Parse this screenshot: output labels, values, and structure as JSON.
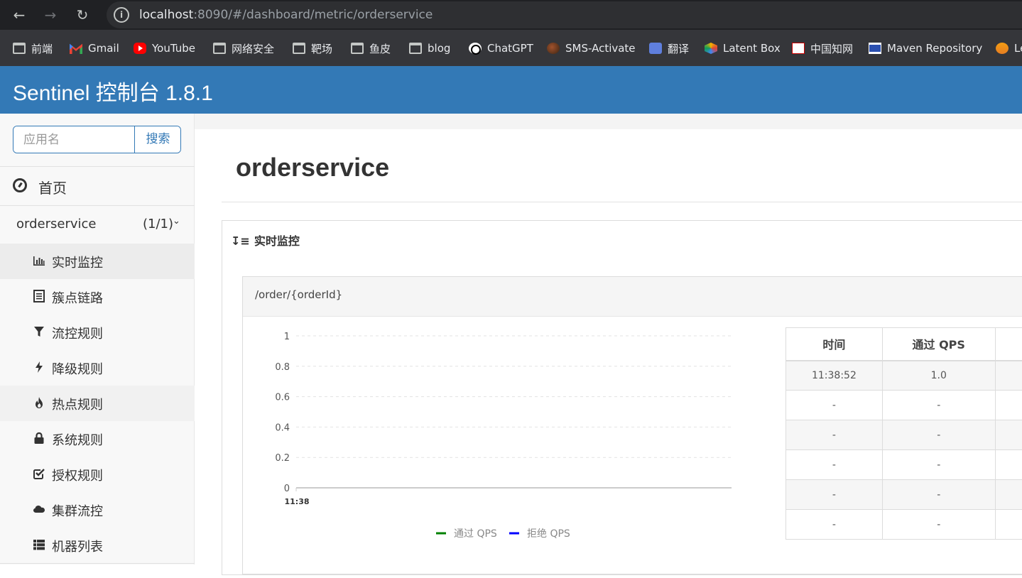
{
  "browser": {
    "url_host": "localhost",
    "url_rest": ":8090/#/dashboard/metric/orderservice",
    "bookmarks": [
      "前端",
      "Gmail",
      "YouTube",
      "网络安全",
      "靶场",
      "鱼皮",
      "blog",
      "ChatGPT",
      "SMS-Activate",
      "翻译",
      "Latent Box",
      "中国知网",
      "Maven Repository",
      "Le"
    ]
  },
  "header": {
    "title": "Sentinel 控制台 1.8.1"
  },
  "sidebar": {
    "search_placeholder": "应用名",
    "search_button": "搜索",
    "home_label": "首页",
    "app": {
      "name": "orderservice",
      "count": "(1/1)"
    },
    "menu": [
      {
        "label": "实时监控",
        "icon": "bar-chart-icon"
      },
      {
        "label": "簇点链路",
        "icon": "list-icon"
      },
      {
        "label": "流控规则",
        "icon": "filter-icon"
      },
      {
        "label": "降级规则",
        "icon": "flash-icon"
      },
      {
        "label": "热点规则",
        "icon": "fire-icon"
      },
      {
        "label": "系统规则",
        "icon": "lock-icon"
      },
      {
        "label": "授权规则",
        "icon": "check-square-icon"
      },
      {
        "label": "集群流控",
        "icon": "cloud-icon"
      },
      {
        "label": "机器列表",
        "icon": "th-list-icon"
      }
    ]
  },
  "main": {
    "title": "orderservice",
    "panel_title": "实时监控",
    "resource": "/order/{orderId}",
    "table": {
      "headers": [
        "时间",
        "通过 QPS"
      ],
      "rows": [
        [
          "11:38:52",
          "1.0"
        ],
        [
          "-",
          "-"
        ],
        [
          "-",
          "-"
        ],
        [
          "-",
          "-"
        ],
        [
          "-",
          "-"
        ],
        [
          "-",
          "-"
        ]
      ]
    }
  },
  "chart_data": {
    "type": "line",
    "x": [
      "11:38"
    ],
    "ylim": [
      0,
      1
    ],
    "yticks": [
      "1",
      "0.8",
      "0.6",
      "0.4",
      "0.2",
      "0"
    ],
    "series": [
      {
        "name": "通过 QPS",
        "color": "#008000",
        "values": []
      },
      {
        "name": "拒绝 QPS",
        "color": "#0000ff",
        "values": []
      }
    ],
    "legend_position": "bottom-center",
    "grid": true
  }
}
